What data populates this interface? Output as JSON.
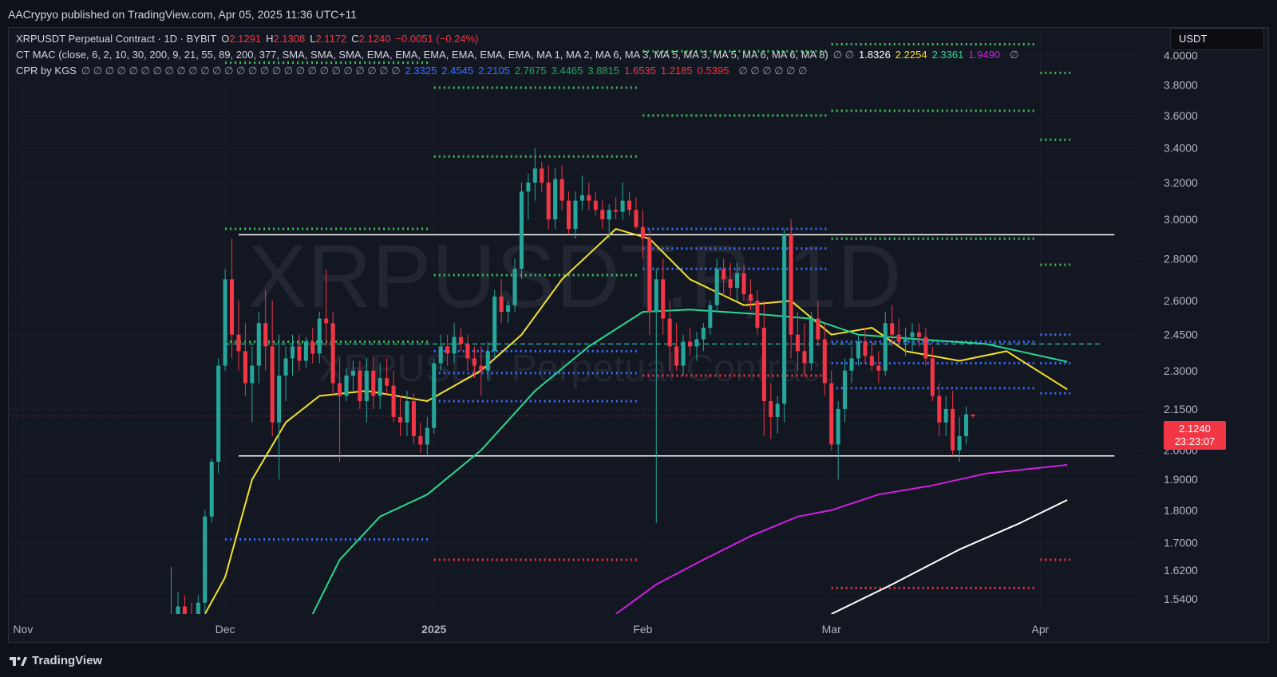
{
  "header": {
    "publisher": "AACrypyo published on TradingView.com, Apr 05, 2025 11:36 UTC+11"
  },
  "symbol_badge": "USDT",
  "legend": {
    "line1": {
      "name": "XRPUSDT Perpetual Contract · 1D · BYBIT",
      "o_label": "O",
      "o": "2.1291",
      "h_label": "H",
      "h": "2.1308",
      "l_label": "L",
      "l": "2.1172",
      "c_label": "C",
      "c": "2.1240",
      "change": "−0.0051 (−0.24%)"
    },
    "line2": {
      "text": "CT MAC (close, 6, 2, 10, 30, 200, 9, 21, 55, 89, 200, 377, SMA, SMA, SMA, EMA, EMA, EMA, EMA, EMA, EMA, MA 1, MA 2, MA 6, MA 3, MA 5, MA 3, MA 5, MA 6, MA 6, MA 8)",
      "nulls": "∅ ∅",
      "values": [
        {
          "v": "1.8326",
          "color": "#ffffff"
        },
        {
          "v": "2.2254",
          "color": "#f5e12a"
        },
        {
          "v": "2.3361",
          "color": "#27d98f"
        },
        {
          "v": "1.9490",
          "color": "#d01fe0"
        }
      ],
      "tail": "∅"
    },
    "line3": {
      "text": "CPR by KGS",
      "nulls": "∅ ∅ ∅ ∅ ∅ ∅ ∅ ∅ ∅ ∅ ∅ ∅ ∅ ∅ ∅ ∅ ∅ ∅ ∅ ∅ ∅ ∅ ∅ ∅ ∅ ∅ ∅",
      "values": [
        {
          "v": "2.3325",
          "color": "#3d6fff"
        },
        {
          "v": "2.4545",
          "color": "#3d6fff"
        },
        {
          "v": "2.2105",
          "color": "#3d6fff"
        },
        {
          "v": "2.7675",
          "color": "#26a65b"
        },
        {
          "v": "3.4465",
          "color": "#26a65b"
        },
        {
          "v": "3.8815",
          "color": "#26a65b"
        },
        {
          "v": "1.6535",
          "color": "#f23645"
        },
        {
          "v": "1.2185",
          "color": "#f23645"
        },
        {
          "v": "0.5395",
          "color": "#f23645"
        }
      ],
      "tail": "∅ ∅ ∅ ∅ ∅ ∅"
    }
  },
  "watermark": {
    "big": "XRPUSDT.P, 1D",
    "small": "XRPUSDT Perpetual Contract"
  },
  "price_tag": {
    "price": "2.1240",
    "countdown": "23:23:07"
  },
  "footer": {
    "brand": "TradingView"
  },
  "colors": {
    "up": "#26a69a",
    "down": "#f23645",
    "yellow": "#f5e12a",
    "green": "#27d98f",
    "magenta": "#d01fe0",
    "white": "#ffffff",
    "blue": "#3d6fff",
    "dotgreen": "#3fbf5a",
    "dotred": "#f23645"
  },
  "chart_data": {
    "type": "candlestick",
    "y_scale": "log",
    "ylim": [
      1.5,
      4.1
    ],
    "y_ticks": [
      "4.0000",
      "3.8000",
      "3.6000",
      "3.4000",
      "3.2000",
      "3.0000",
      "2.8000",
      "2.6000",
      "2.4500",
      "2.3000",
      "2.1500",
      "2.0000",
      "1.9000",
      "1.8000",
      "1.7000",
      "1.6200",
      "1.5400"
    ],
    "x_ticks": [
      {
        "label": "Nov",
        "date": "2024-11-01"
      },
      {
        "label": "Dec",
        "date": "2024-12-01"
      },
      {
        "label": "2025",
        "date": "2025-01-01",
        "bold": true
      },
      {
        "label": "Feb",
        "date": "2025-02-01"
      },
      {
        "label": "Mar",
        "date": "2025-03-01"
      },
      {
        "label": "Apr",
        "date": "2025-04-01"
      }
    ],
    "xlim": [
      "2024-10-30",
      "2025-04-16"
    ],
    "candles_start": "2024-11-23",
    "candles": [
      [
        1.4,
        1.63,
        1.38,
        1.45
      ],
      [
        1.45,
        1.56,
        1.42,
        1.52
      ],
      [
        1.52,
        1.55,
        1.45,
        1.5
      ],
      [
        1.5,
        1.53,
        1.41,
        1.42
      ],
      [
        1.42,
        1.55,
        1.4,
        1.53
      ],
      [
        1.53,
        1.8,
        1.5,
        1.78
      ],
      [
        1.78,
        1.97,
        1.76,
        1.96
      ],
      [
        1.96,
        2.35,
        1.92,
        2.32
      ],
      [
        2.32,
        2.75,
        2.3,
        2.7
      ],
      [
        2.7,
        2.9,
        2.35,
        2.45
      ],
      [
        2.45,
        2.6,
        2.3,
        2.38
      ],
      [
        2.38,
        2.5,
        2.2,
        2.25
      ],
      [
        2.25,
        2.4,
        2.1,
        2.32
      ],
      [
        2.32,
        2.55,
        2.25,
        2.5
      ],
      [
        2.5,
        2.65,
        2.3,
        2.4
      ],
      [
        2.4,
        2.6,
        2.05,
        2.1
      ],
      [
        2.1,
        2.45,
        1.9,
        2.28
      ],
      [
        2.28,
        2.4,
        2.18,
        2.35
      ],
      [
        2.35,
        2.45,
        2.28,
        2.4
      ],
      [
        2.4,
        2.45,
        2.3,
        2.34
      ],
      [
        2.34,
        2.44,
        2.31,
        2.42
      ],
      [
        2.42,
        2.48,
        2.33,
        2.37
      ],
      [
        2.37,
        2.55,
        2.33,
        2.52
      ],
      [
        2.52,
        2.75,
        2.4,
        2.5
      ],
      [
        2.5,
        2.55,
        2.2,
        2.25
      ],
      [
        2.25,
        2.35,
        1.96,
        2.2
      ],
      [
        2.2,
        2.31,
        2.18,
        2.28
      ],
      [
        2.28,
        2.34,
        2.22,
        2.3
      ],
      [
        2.3,
        2.34,
        2.15,
        2.18
      ],
      [
        2.18,
        2.35,
        2.1,
        2.3
      ],
      [
        2.3,
        2.36,
        2.15,
        2.2
      ],
      [
        2.2,
        2.33,
        2.15,
        2.27
      ],
      [
        2.27,
        2.35,
        2.2,
        2.24
      ],
      [
        2.24,
        2.3,
        2.1,
        2.12
      ],
      [
        2.12,
        2.2,
        2.05,
        2.1
      ],
      [
        2.1,
        2.22,
        2.05,
        2.18
      ],
      [
        2.18,
        2.21,
        2.02,
        2.05
      ],
      [
        2.05,
        2.1,
        1.99,
        2.02
      ],
      [
        2.02,
        2.12,
        1.98,
        2.08
      ],
      [
        2.08,
        2.35,
        2.06,
        2.33
      ],
      [
        2.33,
        2.45,
        2.3,
        2.4
      ],
      [
        2.4,
        2.45,
        2.32,
        2.37
      ],
      [
        2.37,
        2.5,
        2.33,
        2.44
      ],
      [
        2.44,
        2.48,
        2.38,
        2.41
      ],
      [
        2.41,
        2.45,
        2.3,
        2.35
      ],
      [
        2.35,
        2.4,
        2.27,
        2.32
      ],
      [
        2.32,
        2.4,
        2.2,
        2.3
      ],
      [
        2.3,
        2.42,
        2.26,
        2.38
      ],
      [
        2.38,
        2.65,
        2.35,
        2.62
      ],
      [
        2.62,
        2.7,
        2.5,
        2.55
      ],
      [
        2.55,
        2.6,
        2.5,
        2.58
      ],
      [
        2.58,
        2.8,
        2.55,
        2.75
      ],
      [
        2.75,
        3.2,
        2.7,
        3.15
      ],
      [
        3.15,
        3.25,
        3.0,
        3.2
      ],
      [
        3.2,
        3.4,
        3.1,
        3.28
      ],
      [
        3.28,
        3.32,
        3.15,
        3.2
      ],
      [
        3.2,
        3.3,
        2.95,
        3.0
      ],
      [
        3.0,
        3.28,
        2.95,
        3.22
      ],
      [
        3.22,
        3.3,
        3.05,
        3.1
      ],
      [
        3.1,
        3.15,
        2.92,
        2.95
      ],
      [
        2.95,
        3.15,
        2.9,
        3.1
      ],
      [
        3.1,
        3.24,
        3.05,
        3.13
      ],
      [
        3.13,
        3.2,
        3.05,
        3.1
      ],
      [
        3.1,
        3.15,
        3.02,
        3.05
      ],
      [
        3.05,
        3.1,
        2.95,
        3.0
      ],
      [
        3.0,
        3.08,
        2.9,
        3.05
      ],
      [
        3.05,
        3.12,
        3.0,
        3.04
      ],
      [
        3.04,
        3.2,
        3.0,
        3.1
      ],
      [
        3.1,
        3.15,
        3.02,
        3.05
      ],
      [
        3.05,
        3.12,
        2.95,
        2.96
      ],
      [
        2.96,
        3.05,
        2.8,
        2.9
      ],
      [
        2.9,
        2.95,
        2.45,
        2.55
      ],
      [
        2.55,
        2.75,
        1.76,
        2.7
      ],
      [
        2.7,
        2.8,
        2.45,
        2.52
      ],
      [
        2.52,
        2.6,
        2.3,
        2.4
      ],
      [
        2.4,
        2.5,
        2.3,
        2.32
      ],
      [
        2.32,
        2.45,
        2.28,
        2.42
      ],
      [
        2.42,
        2.48,
        2.36,
        2.4
      ],
      [
        2.4,
        2.46,
        2.34,
        2.43
      ],
      [
        2.43,
        2.5,
        2.38,
        2.48
      ],
      [
        2.48,
        2.6,
        2.45,
        2.58
      ],
      [
        2.58,
        2.8,
        2.55,
        2.75
      ],
      [
        2.75,
        2.8,
        2.62,
        2.7
      ],
      [
        2.7,
        2.78,
        2.62,
        2.66
      ],
      [
        2.66,
        2.78,
        2.6,
        2.73
      ],
      [
        2.73,
        2.77,
        2.6,
        2.63
      ],
      [
        2.63,
        2.7,
        2.56,
        2.6
      ],
      [
        2.6,
        2.65,
        2.45,
        2.48
      ],
      [
        2.48,
        2.6,
        2.05,
        2.18
      ],
      [
        2.18,
        2.25,
        2.04,
        2.12
      ],
      [
        2.12,
        2.2,
        2.06,
        2.17
      ],
      [
        2.17,
        2.95,
        2.1,
        2.92
      ],
      [
        2.92,
        3.0,
        2.35,
        2.45
      ],
      [
        2.45,
        2.55,
        2.3,
        2.38
      ],
      [
        2.38,
        2.5,
        2.28,
        2.33
      ],
      [
        2.33,
        2.55,
        2.3,
        2.52
      ],
      [
        2.52,
        2.6,
        2.4,
        2.43
      ],
      [
        2.43,
        2.5,
        2.2,
        2.25
      ],
      [
        2.25,
        2.3,
        2.0,
        2.02
      ],
      [
        2.02,
        2.18,
        1.9,
        2.15
      ],
      [
        2.15,
        2.35,
        2.1,
        2.3
      ],
      [
        2.3,
        2.4,
        2.25,
        2.35
      ],
      [
        2.35,
        2.45,
        2.32,
        2.42
      ],
      [
        2.42,
        2.48,
        2.33,
        2.36
      ],
      [
        2.36,
        2.42,
        2.3,
        2.32
      ],
      [
        2.32,
        2.38,
        2.25,
        2.3
      ],
      [
        2.3,
        2.55,
        2.28,
        2.5
      ],
      [
        2.5,
        2.58,
        2.4,
        2.45
      ],
      [
        2.45,
        2.52,
        2.4,
        2.42
      ],
      [
        2.42,
        2.48,
        2.36,
        2.44
      ],
      [
        2.44,
        2.5,
        2.38,
        2.46
      ],
      [
        2.46,
        2.5,
        2.4,
        2.44
      ],
      [
        2.44,
        2.48,
        2.32,
        2.35
      ],
      [
        2.35,
        2.4,
        2.18,
        2.2
      ],
      [
        2.2,
        2.25,
        2.05,
        2.1
      ],
      [
        2.1,
        2.2,
        2.05,
        2.15
      ],
      [
        2.15,
        2.22,
        1.98,
        2.0
      ],
      [
        2.0,
        2.12,
        1.96,
        2.05
      ],
      [
        2.05,
        2.16,
        2.02,
        2.13
      ],
      [
        2.1291,
        2.1308,
        2.1172,
        2.124
      ]
    ],
    "ma_lines": [
      {
        "name": "yellow",
        "points": [
          [
            "2024-11-28",
            1.5
          ],
          [
            "2024-12-01",
            1.6
          ],
          [
            "2024-12-05",
            1.9
          ],
          [
            "2024-12-10",
            2.1
          ],
          [
            "2024-12-15",
            2.2
          ],
          [
            "2024-12-22",
            2.22
          ],
          [
            "2024-12-31",
            2.18
          ],
          [
            "2025-01-08",
            2.3
          ],
          [
            "2025-01-14",
            2.45
          ],
          [
            "2025-01-20",
            2.7
          ],
          [
            "2025-01-28",
            2.95
          ],
          [
            "2025-02-02",
            2.9
          ],
          [
            "2025-02-08",
            2.7
          ],
          [
            "2025-02-16",
            2.58
          ],
          [
            "2025-02-23",
            2.6
          ],
          [
            "2025-03-01",
            2.45
          ],
          [
            "2025-03-07",
            2.48
          ],
          [
            "2025-03-12",
            2.38
          ],
          [
            "2025-03-20",
            2.34
          ],
          [
            "2025-03-27",
            2.38
          ],
          [
            "2025-04-05",
            2.2254
          ]
        ]
      },
      {
        "name": "green",
        "points": [
          [
            "2024-12-14",
            1.5
          ],
          [
            "2024-12-18",
            1.65
          ],
          [
            "2024-12-24",
            1.78
          ],
          [
            "2024-12-31",
            1.85
          ],
          [
            "2025-01-08",
            2.0
          ],
          [
            "2025-01-16",
            2.22
          ],
          [
            "2025-01-24",
            2.4
          ],
          [
            "2025-02-01",
            2.55
          ],
          [
            "2025-02-08",
            2.56
          ],
          [
            "2025-02-18",
            2.54
          ],
          [
            "2025-02-26",
            2.52
          ],
          [
            "2025-03-05",
            2.45
          ],
          [
            "2025-03-14",
            2.43
          ],
          [
            "2025-03-24",
            2.41
          ],
          [
            "2025-04-05",
            2.3361
          ]
        ]
      },
      {
        "name": "magenta",
        "points": [
          [
            "2025-01-28",
            1.5
          ],
          [
            "2025-02-03",
            1.58
          ],
          [
            "2025-02-10",
            1.65
          ],
          [
            "2025-02-17",
            1.72
          ],
          [
            "2025-02-24",
            1.78
          ],
          [
            "2025-03-01",
            1.8
          ],
          [
            "2025-03-08",
            1.85
          ],
          [
            "2025-03-16",
            1.88
          ],
          [
            "2025-03-24",
            1.92
          ],
          [
            "2025-04-05",
            1.949
          ]
        ]
      },
      {
        "name": "white",
        "points": [
          [
            "2025-03-01",
            1.5
          ],
          [
            "2025-03-10",
            1.58
          ],
          [
            "2025-03-20",
            1.68
          ],
          [
            "2025-03-29",
            1.76
          ],
          [
            "2025-04-05",
            1.8326
          ]
        ]
      }
    ],
    "horizontal_lines": [
      {
        "from": "2024-12-03",
        "to": "2025-04-12",
        "y": 2.92,
        "color": "#ffffff"
      },
      {
        "from": "2024-12-03",
        "to": "2025-04-12",
        "y": 1.98,
        "color": "#ffffff"
      },
      {
        "from": "2024-12-01",
        "to": "2025-04-10",
        "y": 2.41,
        "color": "#26a69a",
        "dashed": true
      },
      {
        "from": "2024-10-30",
        "to": "2025-04-16",
        "y": 2.124,
        "color": "#f23645",
        "dotted": true
      }
    ],
    "dotted_levels": [
      {
        "from": "2024-12-01",
        "to": "2024-12-31",
        "y": 2.95,
        "c": "dotgreen"
      },
      {
        "from": "2024-12-01",
        "to": "2024-12-31",
        "y": 2.42,
        "c": "dotgreen"
      },
      {
        "from": "2024-12-01",
        "to": "2024-12-31",
        "y": 1.71,
        "c": "blue"
      },
      {
        "from": "2024-12-01",
        "to": "2024-12-31",
        "y": 3.95,
        "c": "dotgreen"
      },
      {
        "from": "2025-01-01",
        "to": "2025-01-31",
        "y": 3.78,
        "c": "dotgreen"
      },
      {
        "from": "2025-01-01",
        "to": "2025-01-31",
        "y": 3.35,
        "c": "dotgreen"
      },
      {
        "from": "2025-01-01",
        "to": "2025-01-31",
        "y": 2.72,
        "c": "dotgreen"
      },
      {
        "from": "2025-01-01",
        "to": "2025-01-31",
        "y": 2.38,
        "c": "blue"
      },
      {
        "from": "2025-01-01",
        "to": "2025-01-31",
        "y": 2.29,
        "c": "blue"
      },
      {
        "from": "2025-01-01",
        "to": "2025-01-31",
        "y": 2.18,
        "c": "blue"
      },
      {
        "from": "2025-01-01",
        "to": "2025-01-31",
        "y": 1.65,
        "c": "dotred"
      },
      {
        "from": "2025-02-01",
        "to": "2025-02-28",
        "y": 4.03,
        "c": "dotgreen"
      },
      {
        "from": "2025-02-01",
        "to": "2025-02-28",
        "y": 3.6,
        "c": "dotgreen"
      },
      {
        "from": "2025-02-01",
        "to": "2025-02-28",
        "y": 2.95,
        "c": "blue"
      },
      {
        "from": "2025-02-01",
        "to": "2025-02-28",
        "y": 2.85,
        "c": "blue"
      },
      {
        "from": "2025-02-01",
        "to": "2025-02-28",
        "y": 2.75,
        "c": "blue"
      },
      {
        "from": "2025-02-01",
        "to": "2025-02-28",
        "y": 2.28,
        "c": "dotred"
      },
      {
        "from": "2025-03-01",
        "to": "2025-03-31",
        "y": 4.08,
        "c": "dotgreen"
      },
      {
        "from": "2025-03-01",
        "to": "2025-03-31",
        "y": 3.63,
        "c": "dotgreen"
      },
      {
        "from": "2025-03-01",
        "to": "2025-03-31",
        "y": 2.9,
        "c": "dotgreen"
      },
      {
        "from": "2025-03-01",
        "to": "2025-03-31",
        "y": 2.42,
        "c": "blue"
      },
      {
        "from": "2025-03-01",
        "to": "2025-03-31",
        "y": 2.33,
        "c": "blue"
      },
      {
        "from": "2025-03-01",
        "to": "2025-03-31",
        "y": 2.23,
        "c": "blue"
      },
      {
        "from": "2025-03-01",
        "to": "2025-03-31",
        "y": 1.57,
        "c": "dotred"
      },
      {
        "from": "2025-04-01",
        "to": "2025-04-05",
        "y": 3.88,
        "c": "dotgreen"
      },
      {
        "from": "2025-04-01",
        "to": "2025-04-05",
        "y": 3.45,
        "c": "dotgreen"
      },
      {
        "from": "2025-04-01",
        "to": "2025-04-05",
        "y": 2.77,
        "c": "dotgreen"
      },
      {
        "from": "2025-04-01",
        "to": "2025-04-05",
        "y": 2.45,
        "c": "blue"
      },
      {
        "from": "2025-04-01",
        "to": "2025-04-05",
        "y": 2.33,
        "c": "blue"
      },
      {
        "from": "2025-04-01",
        "to": "2025-04-05",
        "y": 2.21,
        "c": "blue"
      },
      {
        "from": "2025-04-01",
        "to": "2025-04-05",
        "y": 1.65,
        "c": "dotred"
      }
    ]
  }
}
